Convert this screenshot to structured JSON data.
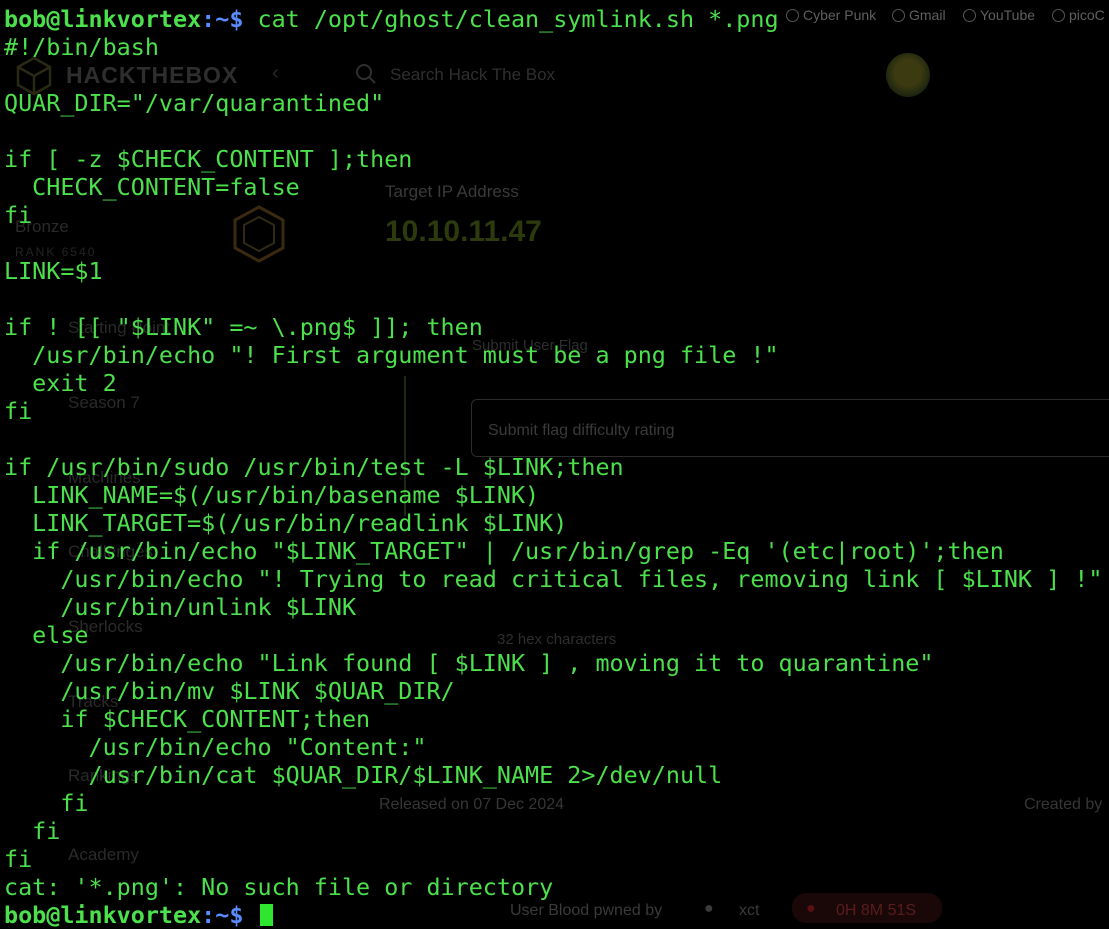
{
  "background": {
    "bookmarks": {
      "cyberpunk": "Cyber Punk",
      "gmail": "Gmail",
      "youtube": "YouTube",
      "pico": "picoC"
    },
    "header": {
      "logo": "HACKTHEBOX",
      "search_placeholder": "Search Hack The Box"
    },
    "sidebar": {
      "rank_tier": "Bronze",
      "rank_label": "RANK 6540",
      "items": [
        "Starting Point",
        "Season 7",
        "Machines",
        "Challenges",
        "Sherlocks",
        "Tracks",
        "Rankings",
        "Academy"
      ]
    },
    "main": {
      "target_label": "Target IP Address",
      "target_ip": "10.10.11.47",
      "submit_flag_label": "Submit User Flag",
      "difficulty_placeholder": "Submit flag difficulty rating",
      "flag_hint": "32 hex characters",
      "released": "Released on 07 Dec 2024",
      "created_by": "Created by",
      "user_blood_label": "User Blood pwned by",
      "user_blood_name": "xct",
      "blood_time": "0H 8M 51S"
    }
  },
  "terminal": {
    "prompt_user": "bob@linkvortex",
    "prompt_path": ":~$",
    "command": " cat /opt/ghost/clean_symlink.sh *.png",
    "lines": [
      "#!/bin/bash",
      "",
      "QUAR_DIR=\"/var/quarantined\"",
      "",
      "if [ -z $CHECK_CONTENT ];then",
      "  CHECK_CONTENT=false",
      "fi",
      "",
      "LINK=$1",
      "",
      "if ! [[ \"$LINK\" =~ \\.png$ ]]; then",
      "  /usr/bin/echo \"! First argument must be a png file !\"",
      "  exit 2",
      "fi",
      "",
      "if /usr/bin/sudo /usr/bin/test -L $LINK;then",
      "  LINK_NAME=$(/usr/bin/basename $LINK)",
      "  LINK_TARGET=$(/usr/bin/readlink $LINK)",
      "  if /usr/bin/echo \"$LINK_TARGET\" | /usr/bin/grep -Eq '(etc|root)';then",
      "    /usr/bin/echo \"! Trying to read critical files, removing link [ $LINK ] !\"",
      "    /usr/bin/unlink $LINK",
      "  else",
      "    /usr/bin/echo \"Link found [ $LINK ] , moving it to quarantine\"",
      "    /usr/bin/mv $LINK $QUAR_DIR/",
      "    if $CHECK_CONTENT;then",
      "      /usr/bin/echo \"Content:\"",
      "      /usr/bin/cat $QUAR_DIR/$LINK_NAME 2>/dev/null",
      "    fi",
      "  fi",
      "fi",
      "cat: '*.png': No such file or directory"
    ],
    "final_prompt_user": "bob@linkvortex",
    "final_prompt_path": ":~$"
  }
}
